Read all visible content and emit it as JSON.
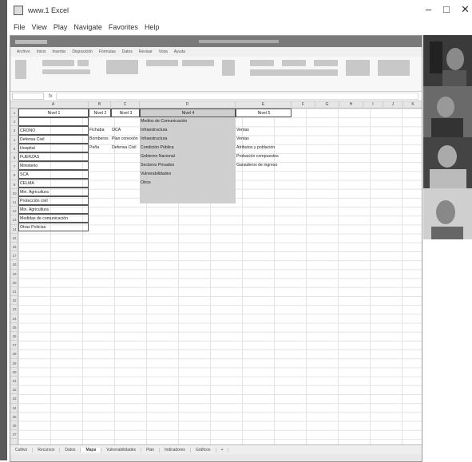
{
  "window": {
    "title": "www.1 Excel",
    "minimize_label": "–",
    "maximize_label": "□",
    "close_label": "✕"
  },
  "menu": [
    "File",
    "View",
    "Play",
    "Navigate",
    "Favorites",
    "Help"
  ],
  "ribbon_tabs": [
    "Archivo",
    "Inicio",
    "Insertar",
    "Disposición",
    "Fórmulas",
    "Datos",
    "Revisar",
    "Vista",
    "Ayuda"
  ],
  "formula_bar": {
    "name_box": "",
    "fx": "fx",
    "content": ""
  },
  "columns": [
    "A",
    "B",
    "C",
    "D",
    "E",
    "F",
    "G",
    "H",
    "I",
    "J",
    "K"
  ],
  "cells": {
    "A1": "Nivel 1",
    "B1": "Nivel 2",
    "C1": "Nivel 3",
    "D1": "Nivel 4",
    "E1": "Nivel 5",
    "A3": "CRONO",
    "B3": "Fichaba",
    "C3": "OCA",
    "A4": "Defensa Civil",
    "B4": "Bomberos",
    "C4": "Plan conexión",
    "A5": "Hospital",
    "B5": "Peña",
    "C5": "Defensa Civil",
    "A6": "FUERZAS",
    "A7": "Ministerio",
    "A8": "SCA",
    "A9": "CELMA",
    "A10": "Min. Agricultura",
    "A11": "Protección civil",
    "A12": "Min. Agricultura",
    "A13": "Medidas de comunicación",
    "A14": "Otras Policías",
    "D2": "Medios de Comunicación",
    "D3": "Infraestructura",
    "D4": "Infraestructura",
    "D5": "Condición Pública",
    "D6": "Gobierno Nacional",
    "D7": "Sectores Privados",
    "D8": "Vulnerabilidades",
    "D9": "Otros",
    "E3": "Ventas",
    "E4": "Ventas",
    "E5": "Atributos y población",
    "E6": "Probación compuestos",
    "E7": "Ganaderos de ingreso"
  },
  "sheet_tabs": [
    "Cultivo",
    "Recursos",
    "Datos",
    "Mapa",
    "Vulnerabilidades",
    "Plan",
    "Indicadores",
    "Gráficos",
    "+"
  ],
  "active_tab_index": 3
}
